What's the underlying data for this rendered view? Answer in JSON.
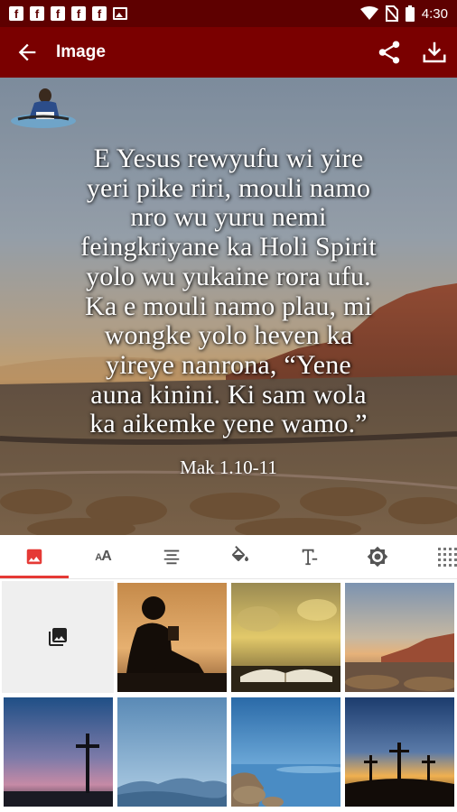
{
  "status_bar": {
    "time": "4:30",
    "notification_icons": [
      "facebook-icon",
      "facebook-icon",
      "facebook-icon",
      "facebook-icon",
      "facebook-icon",
      "image-icon"
    ],
    "system_icons": [
      "wifi-icon",
      "no-sim-icon",
      "battery-icon"
    ]
  },
  "app_bar": {
    "title": "Image",
    "background": "#7a0000",
    "actions": [
      "share-icon",
      "download-icon"
    ]
  },
  "verse": {
    "lines": [
      "E Yesus rewyufu wi yire",
      "yeri pike riri, mouli namo",
      "nro wu yuru nemi",
      "feingkriyane ka Holi Spirit",
      "yolo wu yukaine rora ufu.",
      "Ka e mouli namo plau, mi",
      "wongke yolo heven ka",
      "yireye nanrona, “Yene",
      "auna kinini. Ki sam wola",
      "ka aikemke yene wamo.”"
    ],
    "reference": "Mak 1.10-11"
  },
  "tabs": [
    {
      "name": "background-image",
      "icon": "image-icon",
      "selected": true
    },
    {
      "name": "font-size",
      "icon": "font-size-icon",
      "label": "AA",
      "selected": false
    },
    {
      "name": "alignment",
      "icon": "align-center-icon",
      "selected": false
    },
    {
      "name": "text-color",
      "icon": "paint-bucket-icon",
      "selected": false
    },
    {
      "name": "font-style",
      "icon": "text-format-icon",
      "selected": false
    },
    {
      "name": "brightness",
      "icon": "brightness-icon",
      "selected": false
    },
    {
      "name": "texture",
      "icon": "grid-dots-icon",
      "selected": false
    }
  ],
  "accent_color": "#e53935",
  "gallery": [
    {
      "name": "pick-from-gallery",
      "icon": "photo-library-icon"
    },
    {
      "name": "child-reading-silhouette"
    },
    {
      "name": "open-book-by-water"
    },
    {
      "name": "desert-mountain-sunset"
    },
    {
      "name": "cross-at-dusk"
    },
    {
      "name": "misty-blue-mountains"
    },
    {
      "name": "rocky-lake-shore"
    },
    {
      "name": "three-crosses-sunset"
    }
  ]
}
